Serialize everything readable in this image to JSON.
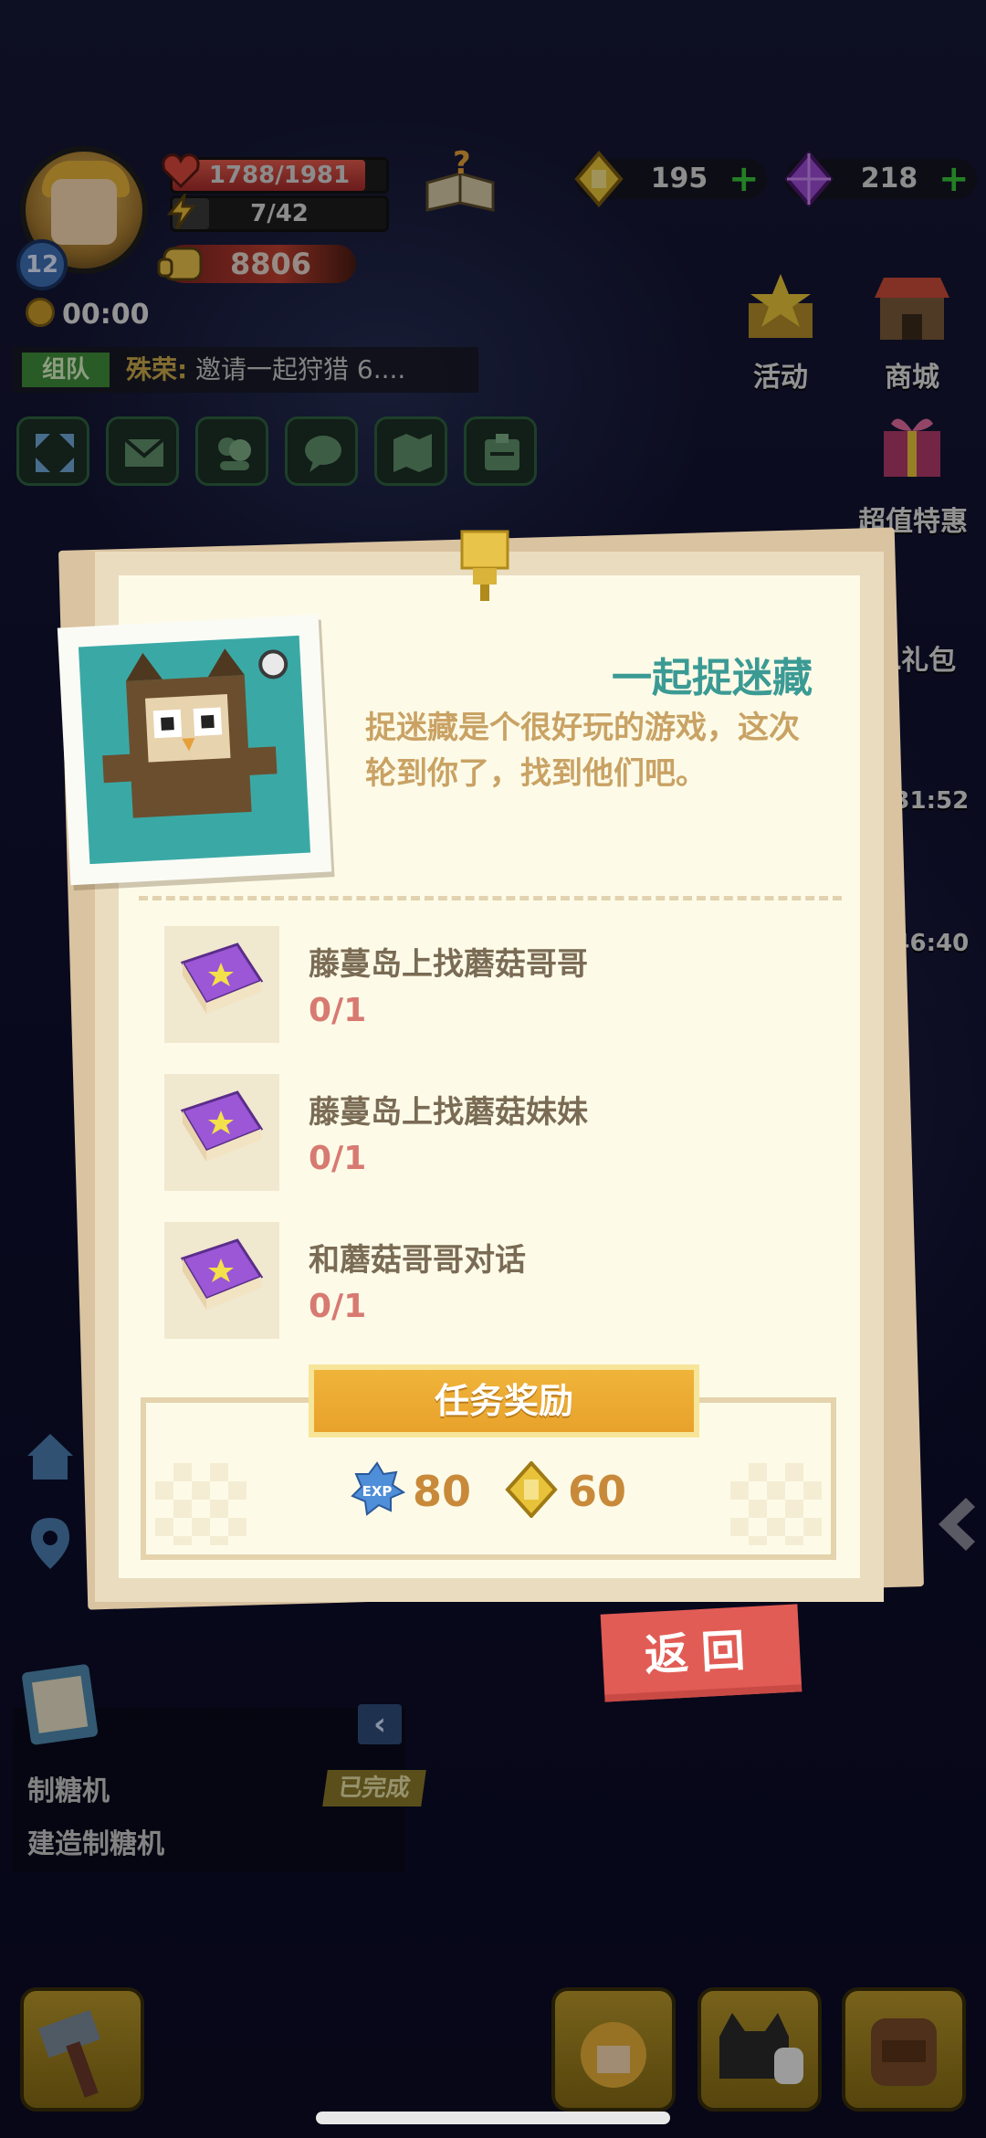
{
  "hud": {
    "level": "12",
    "hp_text": "1788/1981",
    "hp_fraction": 0.9,
    "xp_text": "7/42",
    "xp_fraction": 0.17,
    "power": "8806",
    "timer": "00:00",
    "gold": "195",
    "gems": "218"
  },
  "chat": {
    "tag": "组队",
    "name": "殊荣:",
    "message": "邀请一起狩猎 6...."
  },
  "side_buttons": {
    "activity": "活动",
    "store": "商城",
    "deals": "超值特惠",
    "gift_partial": "L礼包",
    "timer1_partial": ":31:52",
    "timer2_partial": ":46:40"
  },
  "task_tracker": {
    "title": "制糖机",
    "status": "已完成",
    "description": "建造制糖机"
  },
  "quest_dialog": {
    "title": "一起捉迷藏",
    "description": "捉迷藏是个很好玩的游戏，这次轮到你了，找到他们吧。",
    "objectives": [
      {
        "name": "藤蔓岛上找蘑菇哥哥",
        "progress": "0/1"
      },
      {
        "name": "藤蔓岛上找蘑菇妹妹",
        "progress": "0/1"
      },
      {
        "name": "和蘑菇哥哥对话",
        "progress": "0/1"
      }
    ],
    "reward_header": "任务奖励",
    "rewards": {
      "exp": "80",
      "gold": "60"
    },
    "back_label": "返回"
  },
  "colors": {
    "title": "#3b9a94",
    "description": "#c9a264",
    "progress": "#d77a72",
    "reward_banner": "#f0b43a",
    "back_button": "#e15c55"
  }
}
